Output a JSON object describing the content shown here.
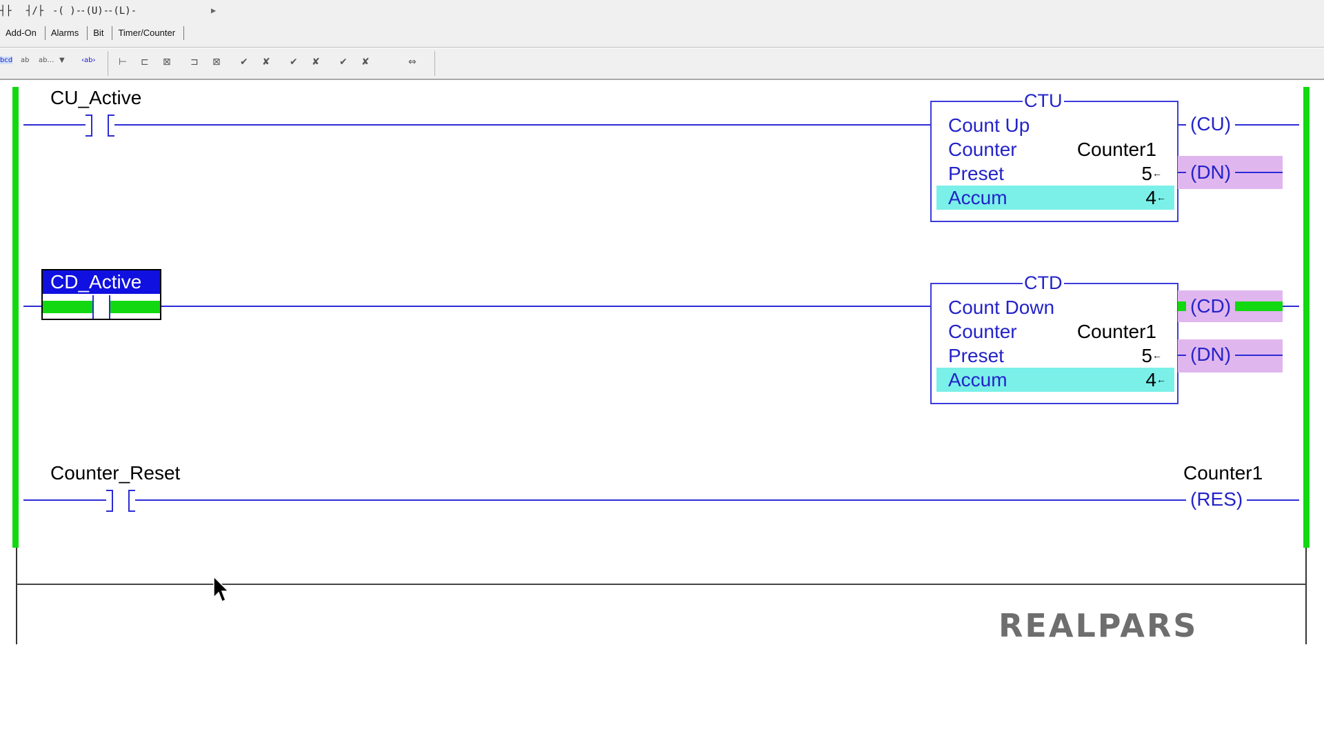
{
  "instruction_bar": {
    "glyphs": [
      "┤├",
      "┤/├",
      "-( )-",
      "-(U)-",
      "-(L)-"
    ],
    "tabs": [
      "Add-On",
      "Alarms",
      "Bit",
      "Timer/Counter"
    ]
  },
  "toolbar": {
    "icons": [
      "rung-icon",
      "branch-icon",
      "edit-icon"
    ]
  },
  "rungs": [
    {
      "contact_tag": "CU_Active",
      "block": {
        "type": "CTU",
        "description": "Count Up",
        "counter_label": "Counter",
        "counter_value": "Counter1",
        "preset_label": "Preset",
        "preset_value": "5",
        "accum_label": "Accum",
        "accum_value": "4"
      },
      "outputs": [
        "CU",
        "DN"
      ]
    },
    {
      "contact_tag": "CD_Active",
      "block": {
        "type": "CTD",
        "description": "Count Down",
        "counter_label": "Counter",
        "counter_value": "Counter1",
        "preset_label": "Preset",
        "preset_value": "5",
        "accum_label": "Accum",
        "accum_value": "4"
      },
      "outputs": [
        "CD",
        "DN"
      ]
    },
    {
      "contact_tag": "Counter_Reset",
      "coil_tag": "Counter1",
      "coil": "RES"
    }
  ],
  "logo": "REALPARS",
  "colors": {
    "rail_active": "#12d812",
    "wire": "#2b2bd6",
    "accum_highlight": "#7af0e8",
    "bit_on": "#e0b6ee",
    "selected_tag": "#1010e0"
  }
}
